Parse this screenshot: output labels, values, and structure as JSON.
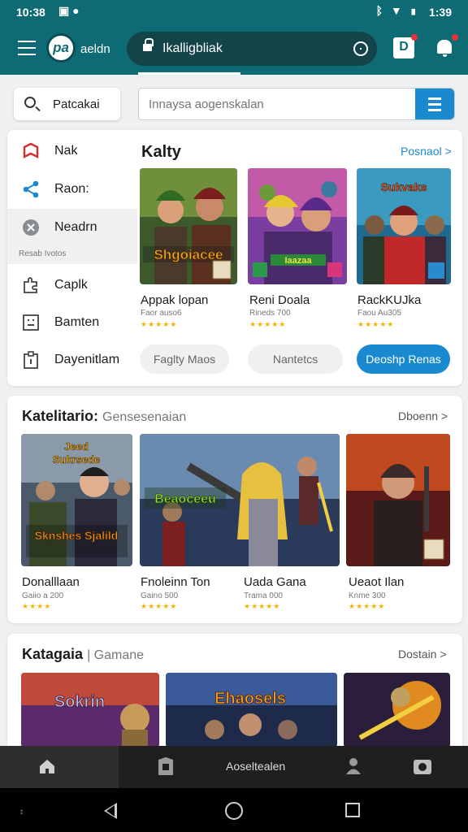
{
  "status": {
    "time": "10:38",
    "clock": "1:39"
  },
  "header": {
    "logo_text": "pa",
    "app_name": "aeldn",
    "url": "Ikalligbliak"
  },
  "search": {
    "pill_label": "Patcakai",
    "placeholder": "Innaysa aogenskalan"
  },
  "sidebar": {
    "items": [
      {
        "label": "Nak",
        "icon": "gamepad-icon"
      },
      {
        "label": "Raon:",
        "icon": "share-icon"
      },
      {
        "label": "Neadrn",
        "icon": "close-circle-icon",
        "sub": "Resab   Ivotos"
      },
      {
        "label": "Caplk",
        "icon": "puzzle-icon"
      },
      {
        "label": "Bamten",
        "icon": "grid-icon"
      },
      {
        "label": "Dayenitlam",
        "icon": "clipboard-icon"
      }
    ]
  },
  "featured": {
    "title": "Kalty",
    "see_all": "Posnaol >",
    "tiles": [
      {
        "art": "Shgoiacee",
        "name": "Appak lopan",
        "sub": "Faor auso6",
        "stars": "★★★★★"
      },
      {
        "art": "Iaazaa",
        "name": "Reni Doala",
        "sub": "Rineds 700",
        "stars": "★★★★★"
      },
      {
        "art": "Sukvaks",
        "name": "RackKUJka",
        "sub": "Faou Au305",
        "stars": "★★★★★"
      }
    ],
    "chips": [
      "Faglty Maos",
      "Nantetcs",
      "Deoshp Renas"
    ]
  },
  "section_two": {
    "title": "Katelitario:",
    "subtitle": "Gensesenaian",
    "see_all": "Dboenn >",
    "tiles": [
      {
        "art_top": "Jeed",
        "art_mid": "Sukrsede",
        "art_bot": "Sknshes Sjalild",
        "name": "Donalllaan",
        "sub": "Gaiio a 200",
        "stars": "★★★★"
      },
      {
        "art": "Beaoceeu",
        "name": "Fnoleinn Ton",
        "sub": "Gaino 500",
        "stars": "★★★★★"
      },
      {
        "art": "",
        "name": "Uada Gana",
        "sub": "Trama 000",
        "stars": "★★★★★"
      },
      {
        "art": "",
        "name": "Ueaot Ilan",
        "sub": "Knme 300",
        "stars": "★★★★★"
      }
    ]
  },
  "section_three": {
    "title": "Katagaia",
    "subtitle": "Gamane",
    "see_all": "Dostain >",
    "tiles": [
      {
        "art": "Sokrin"
      },
      {
        "art": "Ehaosels"
      },
      {
        "art": ""
      }
    ]
  },
  "bottom_nav": {
    "center_label": "Aoseltealen"
  },
  "colors": {
    "app_bar": "#0f6b73",
    "accent": "#1a8ad0",
    "star": "#f5b400",
    "nav": "#1f1f21"
  }
}
